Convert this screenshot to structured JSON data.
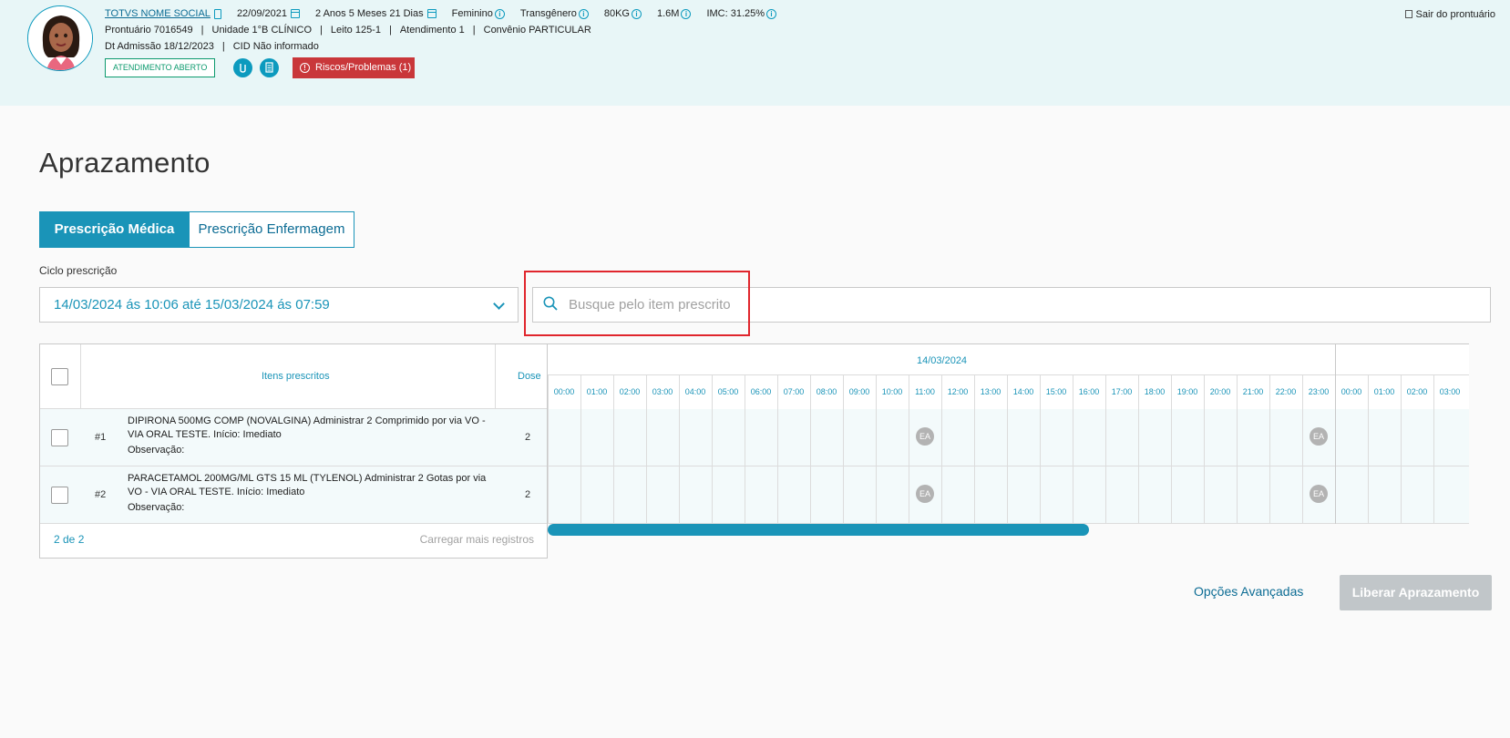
{
  "header": {
    "patient_name": "TOTVS NOME SOCIAL",
    "birth_date": "22/09/2021",
    "age": "2 Anos 5 Meses 21 Dias",
    "sex": "Feminino",
    "gender": "Transgênero",
    "weight": "80KG",
    "height": "1.6M",
    "imc": "IMC: 31.25%",
    "line2": {
      "prontuario": "Prontuário 7016549",
      "unidade": "Unidade 1°B CLÍNICO",
      "leito": "Leito 125-1",
      "atendimento": "Atendimento 1",
      "convenio": "Convênio PARTICULAR"
    },
    "line3": {
      "admissao": "Dt Admissão 18/12/2023",
      "cid": "CID Não informado"
    },
    "status_badge": "ATENDIMENTO ABERTO",
    "risks_button": "Riscos/Problemas (1)",
    "exit_label": "Sair do prontuário"
  },
  "page": {
    "title": "Aprazamento",
    "tabs": [
      {
        "label": "Prescrição Médica",
        "active": true
      },
      {
        "label": "Prescrição Enfermagem",
        "active": false
      }
    ],
    "cycle_label": "Ciclo prescrição",
    "cycle_value": "14/03/2024 ás 10:06 até 15/03/2024 ás 07:59",
    "search_placeholder": "Busque pelo item prescrito"
  },
  "table": {
    "col_items": "Itens prescritos",
    "col_dose": "Dose",
    "rows": [
      {
        "num": "#1",
        "desc": "DIPIRONA 500MG COMP (NOVALGINA) Administrar 2 Comprimido por via VO - VIA ORAL TESTE. Início: Imediato",
        "obs": "Observação:",
        "dose": "2"
      },
      {
        "num": "#2",
        "desc": "PARACETAMOL 200MG/ML GTS 15 ML (TYLENOL) Administrar 2 Gotas por via VO - VIA ORAL TESTE. Início: Imediato",
        "obs": "Observação:",
        "dose": "2"
      }
    ],
    "count": "2 de 2",
    "load_more": "Carregar mais registros"
  },
  "timeline": {
    "date": "14/03/2024",
    "hours": [
      "00:00",
      "01:00",
      "02:00",
      "03:00",
      "04:00",
      "05:00",
      "06:00",
      "07:00",
      "08:00",
      "09:00",
      "10:00",
      "11:00",
      "12:00",
      "13:00",
      "14:00",
      "15:00",
      "16:00",
      "17:00",
      "18:00",
      "19:00",
      "20:00",
      "21:00",
      "22:00",
      "23:00",
      "00:00",
      "01:00",
      "02:00",
      "03:00"
    ],
    "marker_label": "EA",
    "markers": [
      {
        "row": 0,
        "hour_index": 11
      },
      {
        "row": 0,
        "hour_index": 23
      },
      {
        "row": 1,
        "hour_index": 11
      },
      {
        "row": 1,
        "hour_index": 23
      }
    ]
  },
  "footer": {
    "advanced": "Opções Avançadas",
    "release": "Liberar Aprazamento"
  },
  "colors": {
    "accent": "#1a94b8",
    "header_bg": "#e8f6f7",
    "danger": "#c9373a",
    "disabled": "#c1c6c9"
  }
}
